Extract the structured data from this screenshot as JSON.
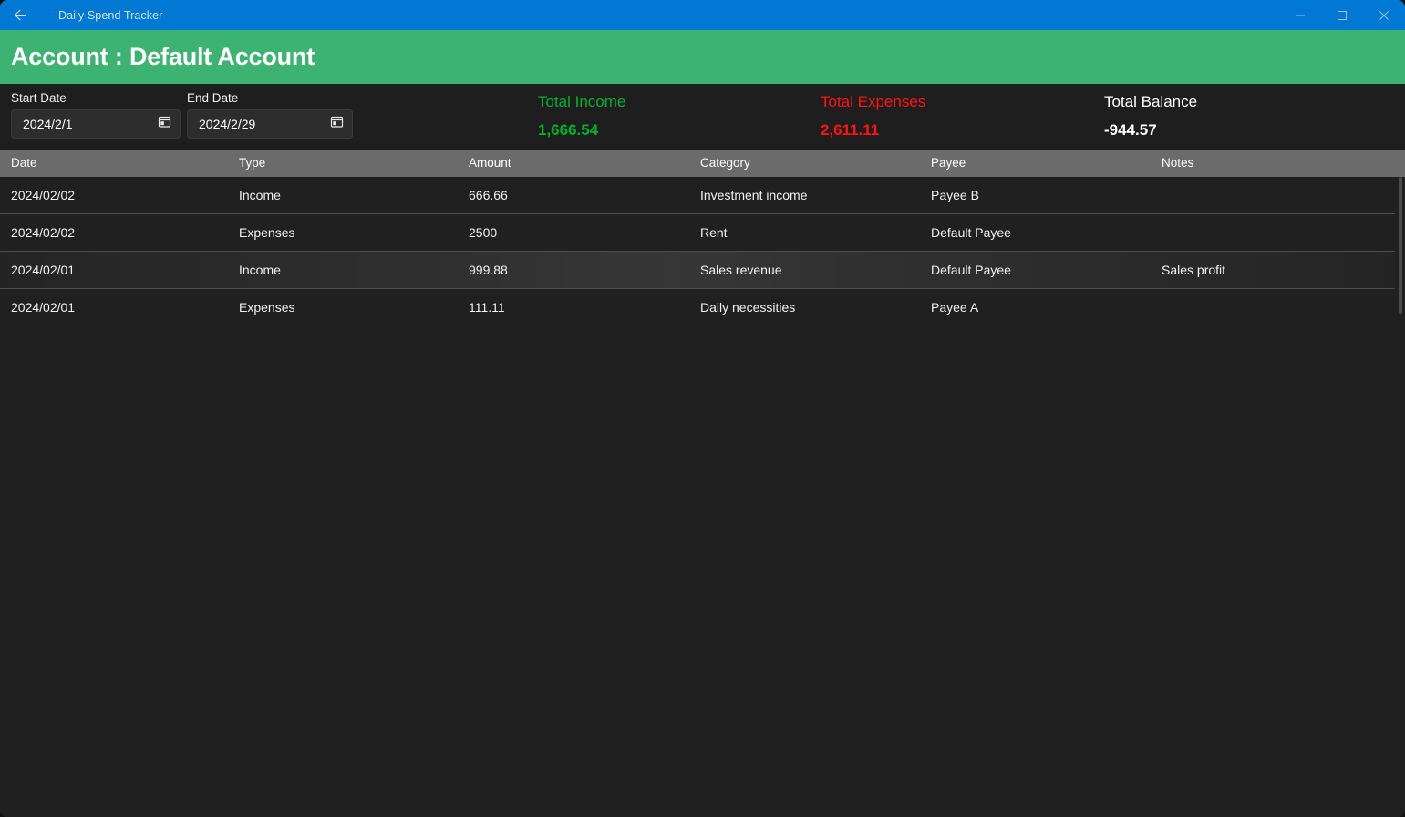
{
  "window": {
    "title": "Daily Spend Tracker",
    "back_icon": "back-arrow-icon",
    "minimize_icon": "minimize-icon",
    "maximize_icon": "maximize-icon",
    "close_icon": "close-icon",
    "titlebar_color": "#0078d4"
  },
  "header": {
    "account_title": "Account : Default Account",
    "background_color": "#3cb371"
  },
  "filters": {
    "start_date": {
      "label": "Start Date",
      "value": "2024/2/1",
      "placeholder": "yyyy/M/d",
      "icon": "calendar-icon"
    },
    "end_date": {
      "label": "End Date",
      "value": "2024/2/29",
      "placeholder": "yyyy/M/d",
      "icon": "calendar-icon"
    },
    "search_button": {
      "icon": "search-icon",
      "color": "#3cb371"
    }
  },
  "summary": {
    "income": {
      "label": "Total Income",
      "value": "1,666.54",
      "color": "#00b32c"
    },
    "expenses": {
      "label": "Total Expenses",
      "value": "2,611.11",
      "color": "#ff1313"
    },
    "balance": {
      "label": "Total Balance",
      "value": "-944.57",
      "color": "#ffffff"
    }
  },
  "table": {
    "columns": [
      {
        "key": "date",
        "label": "Date"
      },
      {
        "key": "type",
        "label": "Type"
      },
      {
        "key": "amount",
        "label": "Amount"
      },
      {
        "key": "category",
        "label": "Category"
      },
      {
        "key": "payee",
        "label": "Payee"
      },
      {
        "key": "notes",
        "label": "Notes"
      }
    ],
    "rows": [
      {
        "date": "2024/02/02",
        "type": "Income",
        "amount": "666.66",
        "category": "Investment income",
        "payee": "Payee B",
        "notes": "",
        "hovered": false
      },
      {
        "date": "2024/02/02",
        "type": "Expenses",
        "amount": "2500",
        "category": "Rent",
        "payee": "Default Payee",
        "notes": "",
        "hovered": false
      },
      {
        "date": "2024/02/01",
        "type": "Income",
        "amount": "999.88",
        "category": "Sales revenue",
        "payee": "Default Payee",
        "notes": "Sales profit",
        "hovered": true
      },
      {
        "date": "2024/02/01",
        "type": "Expenses",
        "amount": "111.11",
        "category": "Daily necessities",
        "payee": "Payee A",
        "notes": "",
        "hovered": false
      }
    ]
  }
}
